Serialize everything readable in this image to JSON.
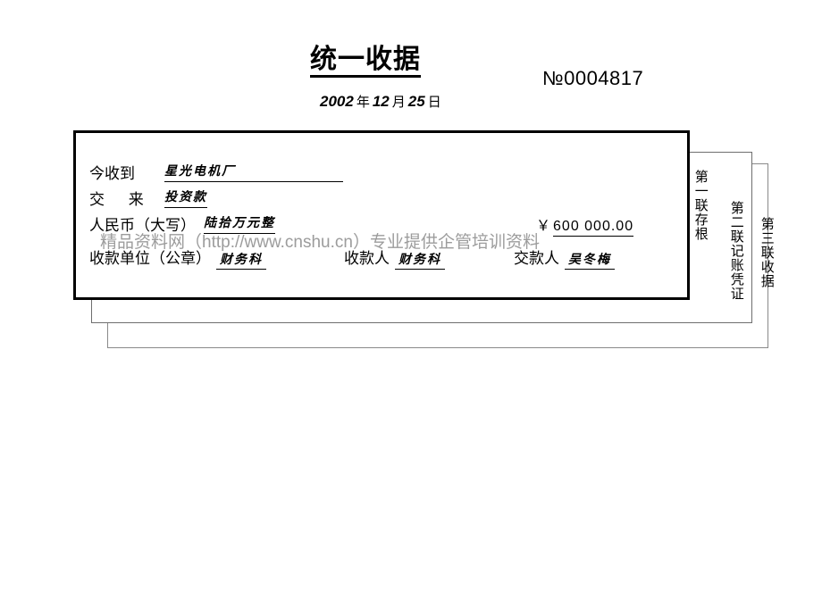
{
  "header": {
    "title": "统一收据",
    "number": "№0004817",
    "date": {
      "year": "2002",
      "year_unit": "年",
      "month": "12",
      "month_unit": "月",
      "day": "25",
      "day_unit": "日"
    }
  },
  "receipt": {
    "rows": {
      "payer_label": "今收到",
      "payer_value": "星光电机厂",
      "item_label": "交  来",
      "item_value": "投资款",
      "words_label": "人民币（大写）",
      "words_value": "陆拾万元整",
      "amount_symbol": "￥",
      "amount_value": "600 000.00"
    },
    "signature": {
      "unit_label": "收款单位（公章）",
      "unit_value": "财务科",
      "payee_label": "收款人",
      "payee_value": "财务科",
      "payer_label": "交款人",
      "payer_value": "吴冬梅"
    }
  },
  "copies": [
    {
      "name": "first",
      "label": "第一联存根"
    },
    {
      "name": "second",
      "label": "第二联记账凭证"
    },
    {
      "name": "third",
      "label": "第三联收据"
    }
  ],
  "watermark": {
    "text": "精品资料网（http://www.cnshu.cn）专业提供企管培训资料",
    "color": "#9c9c9c"
  }
}
